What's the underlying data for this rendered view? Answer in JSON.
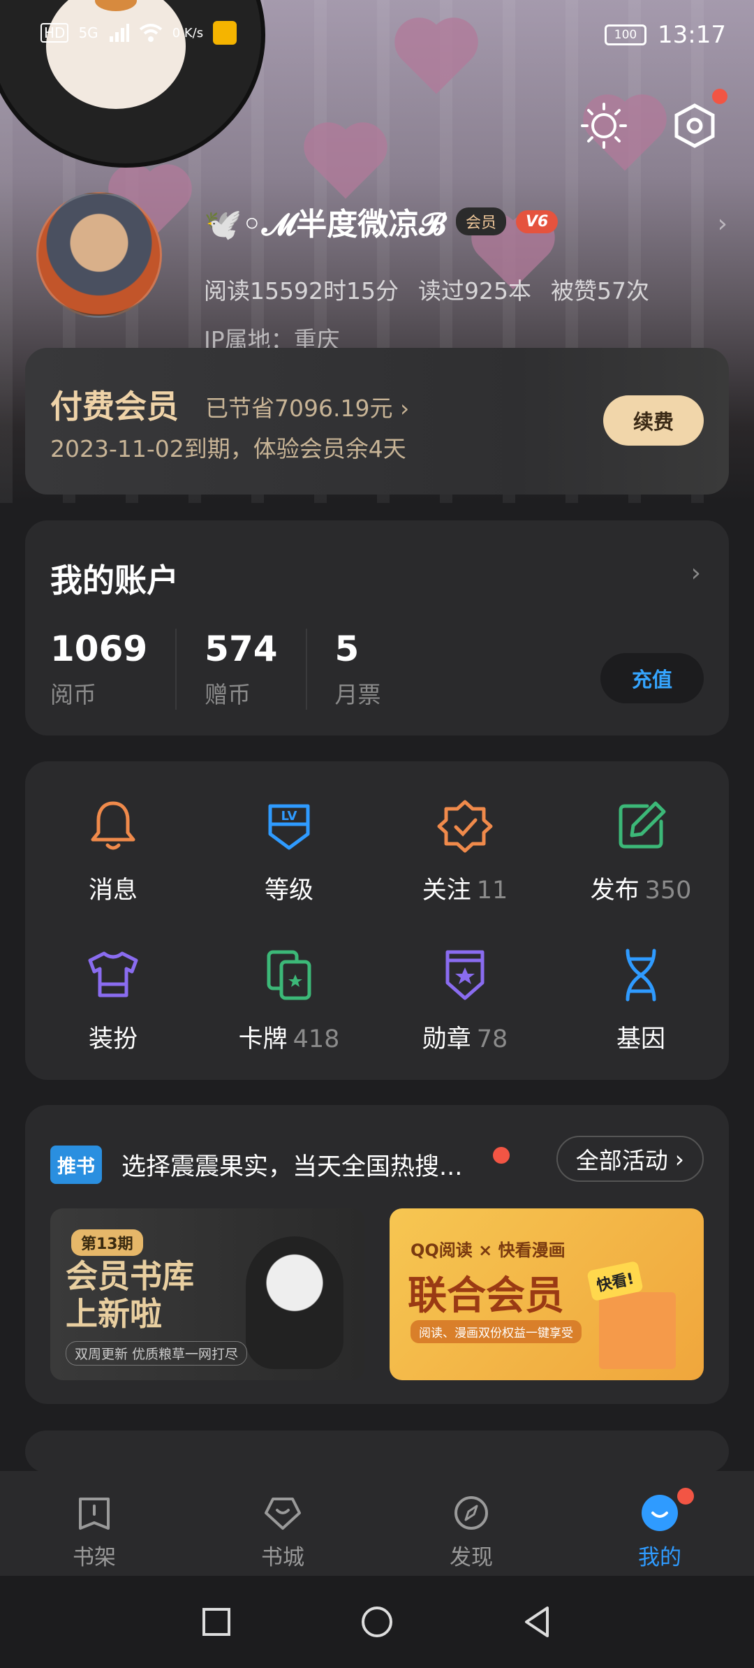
{
  "status_bar": {
    "left_items": [
      "HD",
      "5G",
      "0 K/s"
    ],
    "time": "13:17",
    "battery": "100"
  },
  "profile": {
    "nickname": "🕊️◦𝓜半度微凉𝓑",
    "vip_label": "会员",
    "level_label": "V6",
    "stats": [
      "阅读15592时15分",
      "读过925本",
      "被赞57次"
    ],
    "ip_location": "IP属地：重庆"
  },
  "membership": {
    "title": "付费会员",
    "saved": "已节省7096.19元 ›",
    "expire": "2023-11-02到期，体验会员余4天",
    "renew_label": "续费"
  },
  "account": {
    "title": "我的账户",
    "items": [
      {
        "value": "1069",
        "label": "阅币"
      },
      {
        "value": "574",
        "label": "赠币"
      },
      {
        "value": "5",
        "label": "月票"
      }
    ],
    "recharge_label": "充值"
  },
  "grid": {
    "items": [
      {
        "label": "消息",
        "count": "",
        "icon": "bell-icon",
        "color": "#f08a4b"
      },
      {
        "label": "等级",
        "count": "",
        "icon": "level-icon",
        "color": "#2f9bff"
      },
      {
        "label": "关注",
        "count": "11",
        "icon": "follow-badge-icon",
        "color": "#f08a4b"
      },
      {
        "label": "发布",
        "count": "350",
        "icon": "edit-icon",
        "color": "#3cb878"
      },
      {
        "label": "装扮",
        "count": "",
        "icon": "shirt-icon",
        "color": "#8a6cf0"
      },
      {
        "label": "卡牌",
        "count": "418",
        "icon": "cards-icon",
        "color": "#3cb878"
      },
      {
        "label": "勋章",
        "count": "78",
        "icon": "medal-icon",
        "color": "#8a6cf0"
      },
      {
        "label": "基因",
        "count": "",
        "icon": "dna-icon",
        "color": "#2f9bff"
      }
    ]
  },
  "promo": {
    "tag": "推书",
    "text": "选择震震果实，当天全国热搜...",
    "all_label": "全部活动",
    "banner1": {
      "badge": "第13期",
      "title_line1": "会员书库",
      "title_line2": "上新啦",
      "sub": "双周更新  优质粮草一网打尽"
    },
    "banner2": {
      "top": "QQ阅读 × 快看漫画",
      "title": "联合会员",
      "sub": "阅读、漫画双份权益一键享受",
      "sign": "快看!"
    }
  },
  "tabbar": {
    "tabs": [
      {
        "label": "书架"
      },
      {
        "label": "书城"
      },
      {
        "label": "发现"
      },
      {
        "label": "我的"
      }
    ],
    "accent": "#2f9bff"
  }
}
